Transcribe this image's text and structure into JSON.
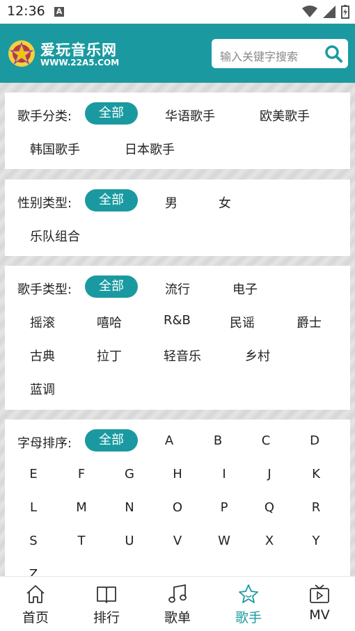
{
  "status": {
    "time": "12:36",
    "notif_letter": "A"
  },
  "header": {
    "logo_title": "爱玩音乐网",
    "logo_url_text": "WWW.22A5.COM",
    "search_placeholder": "输入关键字搜索"
  },
  "filters": {
    "category": {
      "label": "歌手分类:",
      "options": [
        "全部",
        "华语歌手",
        "欧美歌手",
        "韩国歌手",
        "日本歌手"
      ],
      "selected": "全部"
    },
    "gender": {
      "label": "性别类型:",
      "options": [
        "全部",
        "男",
        "女",
        "乐队组合"
      ],
      "selected": "全部"
    },
    "genre": {
      "label": "歌手类型:",
      "options": [
        "全部",
        "流行",
        "电子",
        "摇滚",
        "嘻哈",
        "R&B",
        "民谣",
        "爵士",
        "古典",
        "拉丁",
        "轻音乐",
        "乡村",
        "蓝调"
      ],
      "selected": "全部"
    },
    "letter": {
      "label": "字母排序:",
      "options": [
        "全部",
        "A",
        "B",
        "C",
        "D",
        "E",
        "F",
        "G",
        "H",
        "I",
        "J",
        "K",
        "L",
        "M",
        "N",
        "O",
        "P",
        "Q",
        "R",
        "S",
        "T",
        "U",
        "V",
        "W",
        "X",
        "Y",
        "Z"
      ],
      "selected": "全部"
    }
  },
  "tabs": [
    {
      "label": "首页",
      "icon": "home-icon"
    },
    {
      "label": "排行",
      "icon": "book-icon"
    },
    {
      "label": "歌单",
      "icon": "music-note-icon"
    },
    {
      "label": "歌手",
      "icon": "star-icon",
      "active": true
    },
    {
      "label": "MV",
      "icon": "tv-icon"
    }
  ],
  "colors": {
    "accent": "#1a9aa0"
  }
}
